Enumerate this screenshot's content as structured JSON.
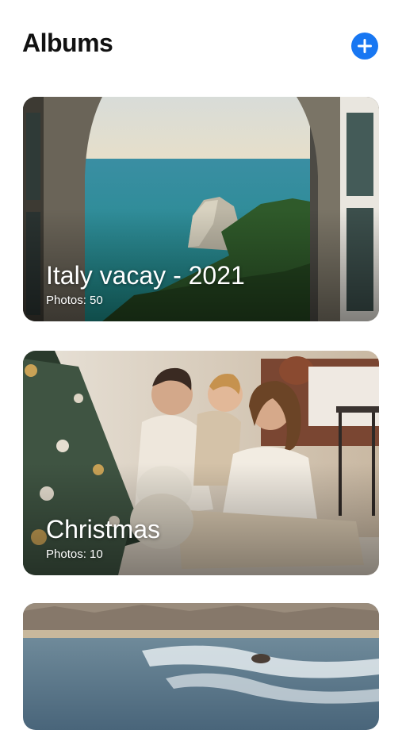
{
  "header": {
    "title": "Albums",
    "add_icon": "plus-circle-icon",
    "accent_color": "#1877f2"
  },
  "albums": [
    {
      "name": "Italy vacay - 2021",
      "count_label": "Photos: 50",
      "image": "seaside-arch-view"
    },
    {
      "name": "Christmas",
      "count_label": "Photos: 10",
      "image": "family-christmas-tree"
    },
    {
      "name": "",
      "count_label": "",
      "image": "beach-waves"
    }
  ]
}
